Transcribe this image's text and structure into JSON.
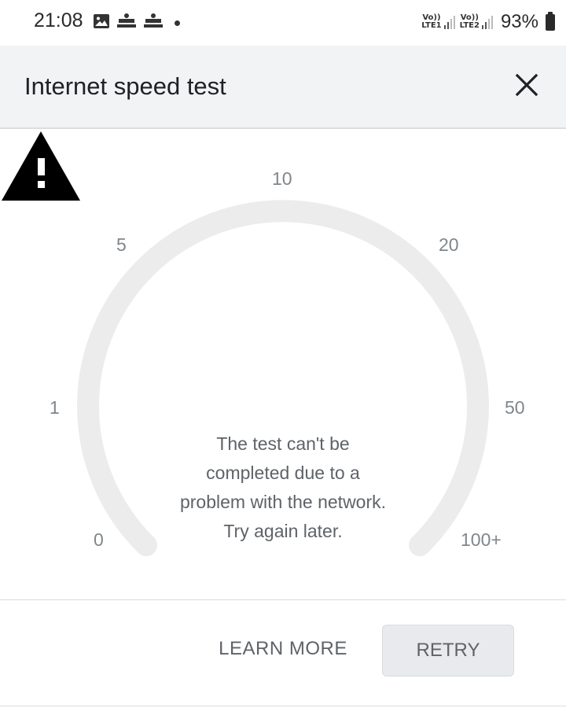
{
  "status_bar": {
    "time": "21:08",
    "notifications": [
      "image-icon",
      "notification-badge",
      "notification-badge"
    ],
    "sim1_label_top": "Vo))",
    "sim1_label_bottom": "LTE1",
    "sim2_label_top": "Vo))",
    "sim2_label_bottom": "LTE2",
    "battery_percent": "93%"
  },
  "app_bar": {
    "title": "Internet speed test",
    "close_icon": "close-icon"
  },
  "gauge": {
    "ticks": [
      "0",
      "1",
      "5",
      "10",
      "20",
      "50",
      "100+"
    ],
    "track_color": "#ebebeb",
    "warning_icon": "warning-icon"
  },
  "message": {
    "lines": [
      "The test can't be",
      "completed due to a",
      "problem with the network.",
      "Try again later."
    ]
  },
  "actions": {
    "learn_more_label": "LEARN MORE",
    "retry_label": "RETRY"
  }
}
